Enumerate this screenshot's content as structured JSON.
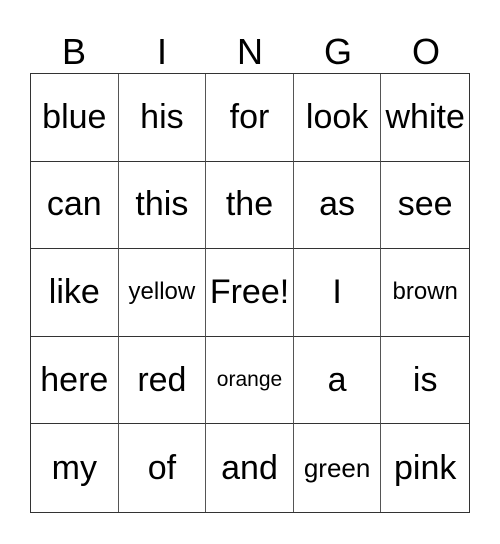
{
  "header": {
    "letters": [
      "B",
      "I",
      "N",
      "G",
      "O"
    ]
  },
  "board": {
    "rows": [
      [
        "blue",
        "his",
        "for",
        "look",
        "white"
      ],
      [
        "can",
        "this",
        "the",
        "as",
        "see"
      ],
      [
        "like",
        "yellow",
        "Free!",
        "I",
        "brown"
      ],
      [
        "here",
        "red",
        "orange",
        "a",
        "is"
      ],
      [
        "my",
        "of",
        "and",
        "green",
        "pink"
      ]
    ]
  }
}
